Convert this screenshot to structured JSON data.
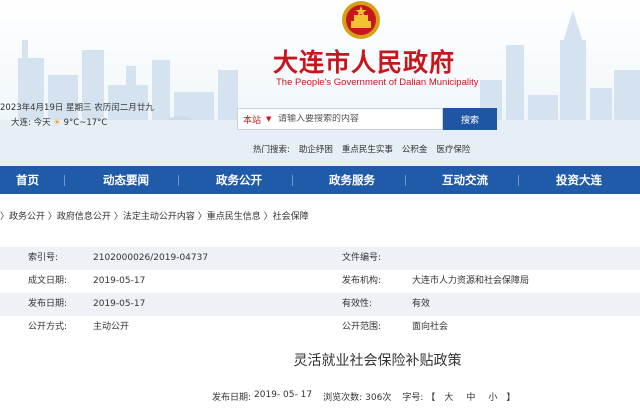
{
  "header": {
    "site_title": "大连市人民政府",
    "site_subtitle": "The People's Government of Dalian Municipality",
    "date_line": "2023年4月19日 星期三 农历闰二月廿九",
    "weather": {
      "city": "大连:",
      "day": "今天",
      "temp": "9°C~17°C"
    },
    "search": {
      "scope": "本站",
      "placeholder": "请输入要搜索的内容",
      "button": "搜索"
    },
    "hot": {
      "label": "热门搜索:",
      "items": [
        "助企纾困",
        "重点民生实事",
        "公积金",
        "医疗保险"
      ]
    }
  },
  "nav": [
    "首页",
    "动态要闻",
    "政务公开",
    "政务服务",
    "互动交流",
    "投资大连"
  ],
  "breadcrumb": [
    "政务公开",
    "政府信息公开",
    "法定主动公开内容",
    "重点民生信息",
    "社会保障"
  ],
  "meta": {
    "index_label": "索引号:",
    "index_value": "2102000026/2019-04737",
    "docno_label": "文件编号:",
    "docno_value": "",
    "created_label": "成文日期:",
    "created_value": "2019-05-17",
    "org_label": "发布机构:",
    "org_value": "大连市人力资源和社会保障局",
    "published_label": "发布日期:",
    "published_value": "2019-05-17",
    "validity_label": "有效性:",
    "validity_value": "有效",
    "method_label": "公开方式:",
    "method_value": "主动公开",
    "scope_label": "公开范围:",
    "scope_value": "面向社会"
  },
  "article": {
    "title": "灵活就业社会保险补贴政策",
    "publish_label": "发布日期:",
    "publish_date": "2019- 05- 17",
    "views_label": "浏览次数:",
    "views": "306次",
    "fontsize_label": "字号:",
    "bracket_open": "【",
    "large": "大",
    "medium": "中",
    "small": "小",
    "bracket_close": "】"
  },
  "colors": {
    "brand_red": "#c8161d",
    "nav_blue": "#1f5ba8",
    "search_blue": "#1f56a3"
  },
  "icons": {
    "emblem": "national-emblem-icon",
    "weather": "sun-icon",
    "caret": "caret-down-icon"
  }
}
